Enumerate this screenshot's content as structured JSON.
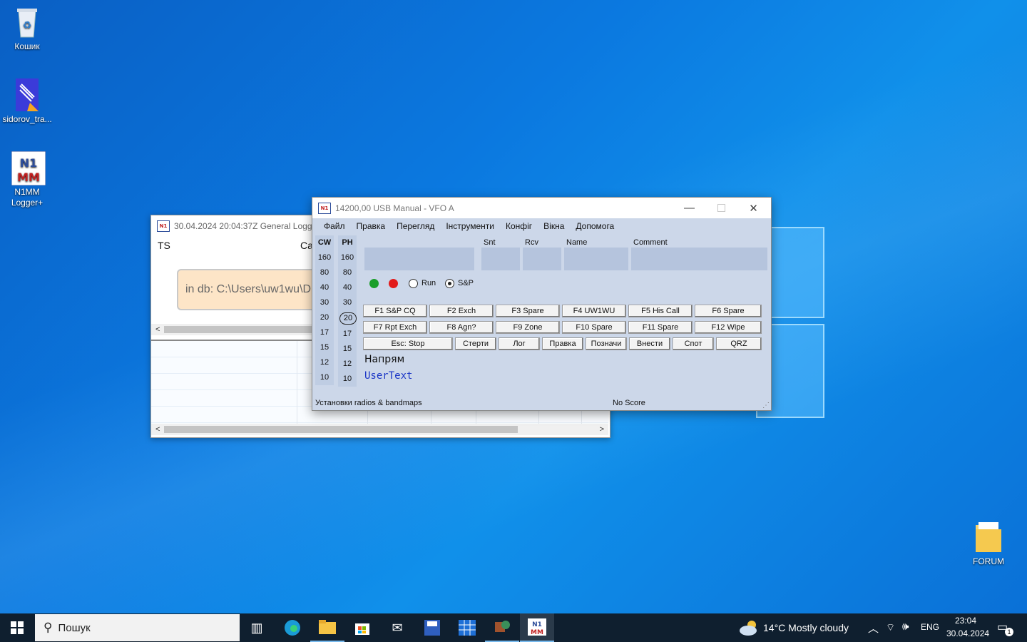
{
  "desktop": {
    "icons": [
      {
        "label": "Кошик"
      },
      {
        "label": "sidorov_tra..."
      },
      {
        "label": "N1MM Logger+"
      },
      {
        "label": "FORUM"
      }
    ]
  },
  "log_window": {
    "title": "30.04.2024 20:04:37Z  General Logging",
    "col_ts": "TS",
    "col_call": "Ca",
    "db_text": "in db: C:\\Users\\uw1wu\\D"
  },
  "entry_window": {
    "title": "14200,00 USB Manual - VFO A",
    "menu": [
      "Файл",
      "Правка",
      "Перегляд",
      "Інструменти",
      "Конфіг",
      "Вікна",
      "Допомога"
    ],
    "cw_header": "CW",
    "ph_header": "PH",
    "bands": [
      "160",
      "80",
      "40",
      "30",
      "20",
      "17",
      "15",
      "12",
      "10"
    ],
    "selected_band": "20",
    "field_labels": {
      "snt": "Snt",
      "rcv": "Rcv",
      "name": "Name",
      "comment": "Comment"
    },
    "run_label": "Run",
    "sp_label": "S&P",
    "mode_selected": "S&P",
    "fkeys_row1": [
      "F1 S&P CQ",
      "F2 Exch",
      "F3 Spare",
      "F4 UW1WU",
      "F5 His Call",
      "F6 Spare"
    ],
    "fkeys_row2": [
      "F7 Rpt Exch",
      "F8 Agn?",
      "F9 Zone",
      "F10 Spare",
      "F11 Spare",
      "F12 Wipe"
    ],
    "row3": [
      "Esc: Stop",
      "Стерти",
      "Лог",
      "Правка",
      "Позначи",
      "Внести",
      "Спот",
      "QRZ"
    ],
    "direction_label": "Напрям",
    "user_text": "UserText",
    "status_left": "Установки radios & bandmaps",
    "status_right": "No Score"
  },
  "taskbar": {
    "search_placeholder": "Пошук",
    "weather": "14°C  Mostly cloudy",
    "lang": "ENG",
    "time": "23:04",
    "date": "30.04.2024",
    "notif_count": "1"
  },
  "colors": {
    "accent": "#0b79e0",
    "entry_bg": "#ccd7e9",
    "field_bg": "#b5c4dd",
    "taskbar": "#0f1f2f"
  }
}
